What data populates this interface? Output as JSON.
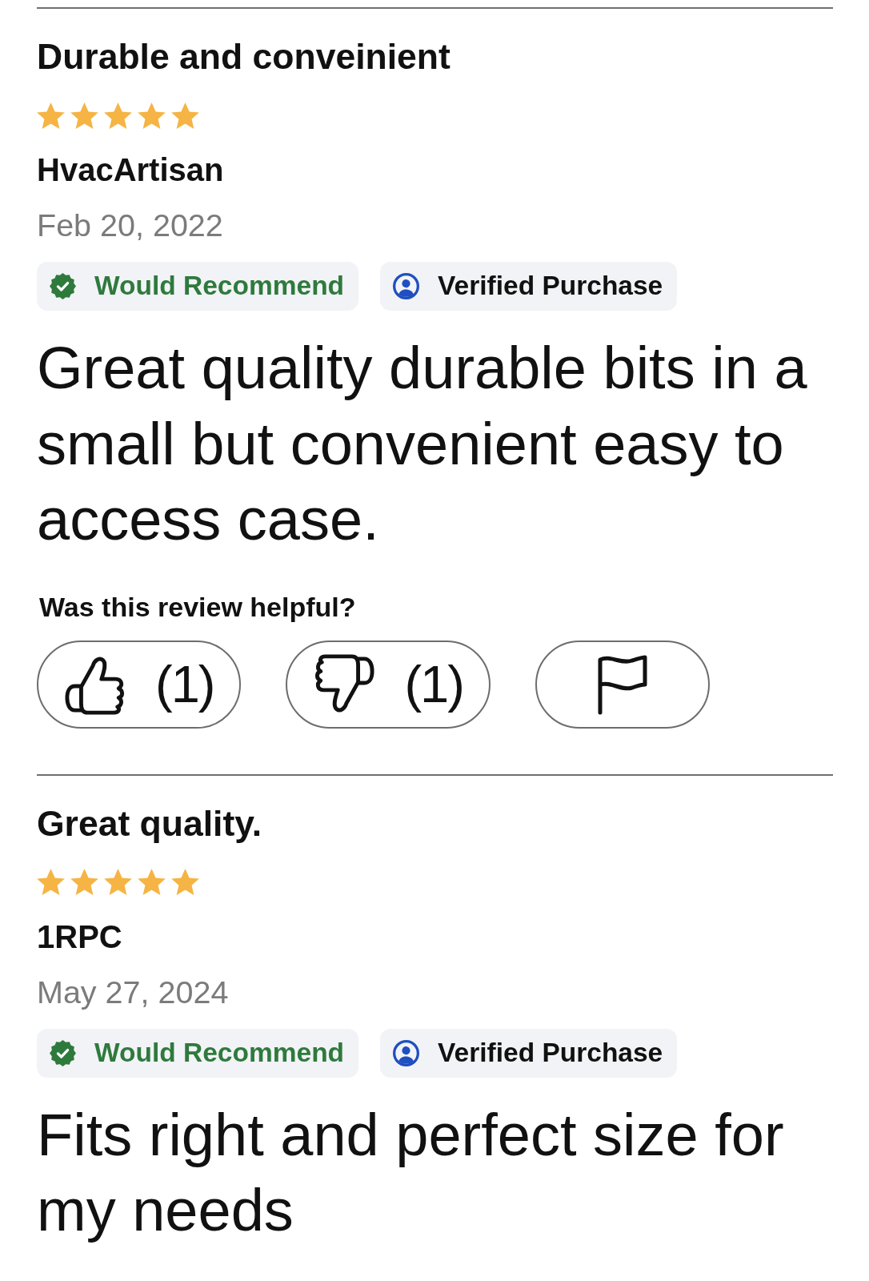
{
  "reviews": [
    {
      "title": "Durable and conveinient",
      "stars": 5,
      "author": "HvacArtisan",
      "date": "Feb 20, 2022",
      "badges": [
        {
          "kind": "recommend",
          "label": "Would Recommend"
        },
        {
          "kind": "verified",
          "label": "Verified Purchase"
        }
      ],
      "text": "Great quality durable bits in a small but convenient easy to access case.",
      "helpful": {
        "prompt": "Was this review helpful?",
        "buttons": [
          {
            "kind": "up",
            "count": "(1)"
          },
          {
            "kind": "down",
            "count": "(1)"
          },
          {
            "kind": "flag"
          }
        ]
      }
    },
    {
      "title": "Great quality.",
      "stars": 5,
      "author": "1RPC",
      "date": "May 27, 2024",
      "badges": [
        {
          "kind": "recommend",
          "label": "Would Recommend"
        },
        {
          "kind": "verified",
          "label": "Verified Purchase"
        }
      ],
      "text": "Fits right and perfect size for my needs"
    }
  ]
}
